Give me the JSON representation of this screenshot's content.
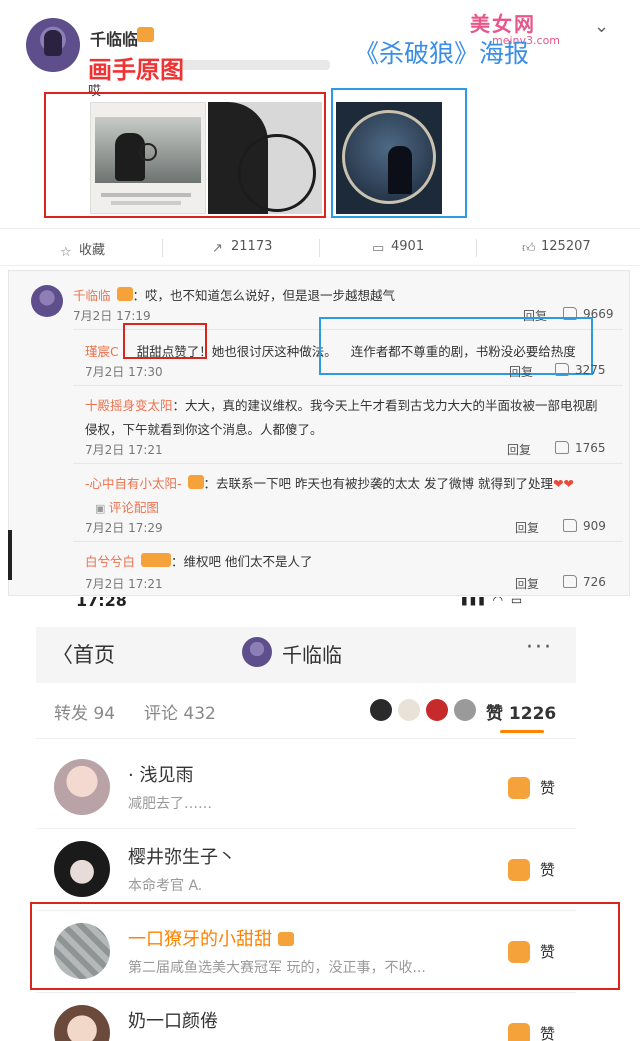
{
  "post": {
    "author": "千临临",
    "chevron": "⌄",
    "watermark": "美女网",
    "watermark_sub": "meinv3.com",
    "text": "哎",
    "annotation_red": "画手原图",
    "annotation_blue": "《杀破狼》海报",
    "actions": {
      "favorite": "收藏",
      "reposts": "21173",
      "comments": "4901",
      "likes": "125207"
    }
  },
  "comments": {
    "main": {
      "author": "千临临",
      "text": "：哎，也不知道怎么说好，但是退一步越想越气",
      "date": "7月2日 17:19",
      "reply": "回复",
      "likes": "9669"
    },
    "replies": [
      {
        "author": "瑾宸C",
        "text_a": "甜甜点赞了！",
        "text_b": "她也很讨厌这种做法。",
        "text_c": "连作者都不尊重的剧，书粉没必要给热度",
        "date": "7月2日 17:30",
        "reply": "回复",
        "likes": "3275"
      },
      {
        "author": "十殿摇身变太阳",
        "text": "：大大，真的建议维权。我今天上午才看到古戈力大大的半面妆被一部电视剧",
        "text2": "侵权，下午就看到你这个消息。人都傻了。",
        "date": "7月2日 17:21",
        "reply": "回复",
        "likes": "1765"
      },
      {
        "author": "-心中自有小太阳-",
        "text": "：去联系一下吧  昨天也有被抄袭的太太  发了微博 就得到了处理",
        "hearts": "❤❤",
        "pic_label": "评论配图",
        "date": "7月2日 17:29",
        "reply": "回复",
        "likes": "909"
      },
      {
        "author": "白兮兮白",
        "text": "：维权吧  他们太不是人了",
        "date": "7月2日 17:21",
        "reply": "回复",
        "likes": "726"
      }
    ]
  },
  "phone": {
    "time": "17:28",
    "status": "▮▮▮ ◠ ▭",
    "back_label": "首页",
    "title": "千临临",
    "more": "···",
    "tabs": {
      "reposts": "转发 94",
      "comments": "评论 432",
      "likes": "赞 1226"
    },
    "users": [
      {
        "name": "· 浅见雨",
        "desc": "减肥去了……",
        "like": "赞"
      },
      {
        "name": "樱井弥生子丶",
        "desc": "本命考官 A.",
        "like": "赞"
      },
      {
        "name": "一口獠牙的小甜甜",
        "desc": "第二届咸鱼选美大赛冠军 玩的，没正事，不收...",
        "like": "赞"
      },
      {
        "name": "奶一口颜倦",
        "desc": "",
        "like": "赞"
      }
    ]
  },
  "colors": {
    "annotation_red": "#d9251c",
    "annotation_blue": "#2d9be0",
    "accent_orange": "#ff8200",
    "name_orange": "#eb7350"
  }
}
